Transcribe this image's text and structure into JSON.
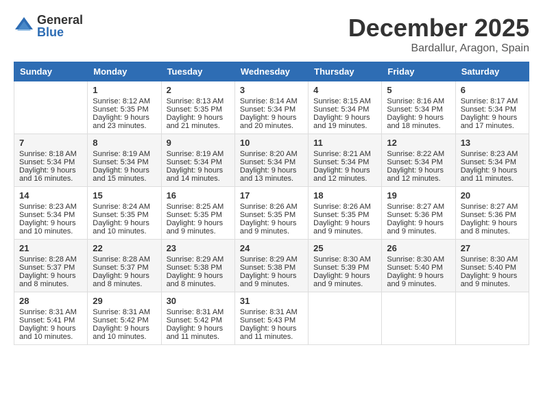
{
  "logo": {
    "general": "General",
    "blue": "Blue"
  },
  "title": "December 2025",
  "subtitle": "Bardallur, Aragon, Spain",
  "days_of_week": [
    "Sunday",
    "Monday",
    "Tuesday",
    "Wednesday",
    "Thursday",
    "Friday",
    "Saturday"
  ],
  "weeks": [
    [
      {
        "day": "",
        "info": ""
      },
      {
        "day": "1",
        "info": "Sunrise: 8:12 AM\nSunset: 5:35 PM\nDaylight: 9 hours\nand 23 minutes."
      },
      {
        "day": "2",
        "info": "Sunrise: 8:13 AM\nSunset: 5:35 PM\nDaylight: 9 hours\nand 21 minutes."
      },
      {
        "day": "3",
        "info": "Sunrise: 8:14 AM\nSunset: 5:34 PM\nDaylight: 9 hours\nand 20 minutes."
      },
      {
        "day": "4",
        "info": "Sunrise: 8:15 AM\nSunset: 5:34 PM\nDaylight: 9 hours\nand 19 minutes."
      },
      {
        "day": "5",
        "info": "Sunrise: 8:16 AM\nSunset: 5:34 PM\nDaylight: 9 hours\nand 18 minutes."
      },
      {
        "day": "6",
        "info": "Sunrise: 8:17 AM\nSunset: 5:34 PM\nDaylight: 9 hours\nand 17 minutes."
      }
    ],
    [
      {
        "day": "7",
        "info": "Sunrise: 8:18 AM\nSunset: 5:34 PM\nDaylight: 9 hours\nand 16 minutes."
      },
      {
        "day": "8",
        "info": "Sunrise: 8:19 AM\nSunset: 5:34 PM\nDaylight: 9 hours\nand 15 minutes."
      },
      {
        "day": "9",
        "info": "Sunrise: 8:19 AM\nSunset: 5:34 PM\nDaylight: 9 hours\nand 14 minutes."
      },
      {
        "day": "10",
        "info": "Sunrise: 8:20 AM\nSunset: 5:34 PM\nDaylight: 9 hours\nand 13 minutes."
      },
      {
        "day": "11",
        "info": "Sunrise: 8:21 AM\nSunset: 5:34 PM\nDaylight: 9 hours\nand 12 minutes."
      },
      {
        "day": "12",
        "info": "Sunrise: 8:22 AM\nSunset: 5:34 PM\nDaylight: 9 hours\nand 12 minutes."
      },
      {
        "day": "13",
        "info": "Sunrise: 8:23 AM\nSunset: 5:34 PM\nDaylight: 9 hours\nand 11 minutes."
      }
    ],
    [
      {
        "day": "14",
        "info": "Sunrise: 8:23 AM\nSunset: 5:34 PM\nDaylight: 9 hours\nand 10 minutes."
      },
      {
        "day": "15",
        "info": "Sunrise: 8:24 AM\nSunset: 5:35 PM\nDaylight: 9 hours\nand 10 minutes."
      },
      {
        "day": "16",
        "info": "Sunrise: 8:25 AM\nSunset: 5:35 PM\nDaylight: 9 hours\nand 9 minutes."
      },
      {
        "day": "17",
        "info": "Sunrise: 8:26 AM\nSunset: 5:35 PM\nDaylight: 9 hours\nand 9 minutes."
      },
      {
        "day": "18",
        "info": "Sunrise: 8:26 AM\nSunset: 5:35 PM\nDaylight: 9 hours\nand 9 minutes."
      },
      {
        "day": "19",
        "info": "Sunrise: 8:27 AM\nSunset: 5:36 PM\nDaylight: 9 hours\nand 9 minutes."
      },
      {
        "day": "20",
        "info": "Sunrise: 8:27 AM\nSunset: 5:36 PM\nDaylight: 9 hours\nand 8 minutes."
      }
    ],
    [
      {
        "day": "21",
        "info": "Sunrise: 8:28 AM\nSunset: 5:37 PM\nDaylight: 9 hours\nand 8 minutes."
      },
      {
        "day": "22",
        "info": "Sunrise: 8:28 AM\nSunset: 5:37 PM\nDaylight: 9 hours\nand 8 minutes."
      },
      {
        "day": "23",
        "info": "Sunrise: 8:29 AM\nSunset: 5:38 PM\nDaylight: 9 hours\nand 8 minutes."
      },
      {
        "day": "24",
        "info": "Sunrise: 8:29 AM\nSunset: 5:38 PM\nDaylight: 9 hours\nand 9 minutes."
      },
      {
        "day": "25",
        "info": "Sunrise: 8:30 AM\nSunset: 5:39 PM\nDaylight: 9 hours\nand 9 minutes."
      },
      {
        "day": "26",
        "info": "Sunrise: 8:30 AM\nSunset: 5:40 PM\nDaylight: 9 hours\nand 9 minutes."
      },
      {
        "day": "27",
        "info": "Sunrise: 8:30 AM\nSunset: 5:40 PM\nDaylight: 9 hours\nand 9 minutes."
      }
    ],
    [
      {
        "day": "28",
        "info": "Sunrise: 8:31 AM\nSunset: 5:41 PM\nDaylight: 9 hours\nand 10 minutes."
      },
      {
        "day": "29",
        "info": "Sunrise: 8:31 AM\nSunset: 5:42 PM\nDaylight: 9 hours\nand 10 minutes."
      },
      {
        "day": "30",
        "info": "Sunrise: 8:31 AM\nSunset: 5:42 PM\nDaylight: 9 hours\nand 11 minutes."
      },
      {
        "day": "31",
        "info": "Sunrise: 8:31 AM\nSunset: 5:43 PM\nDaylight: 9 hours\nand 11 minutes."
      },
      {
        "day": "",
        "info": ""
      },
      {
        "day": "",
        "info": ""
      },
      {
        "day": "",
        "info": ""
      }
    ]
  ]
}
